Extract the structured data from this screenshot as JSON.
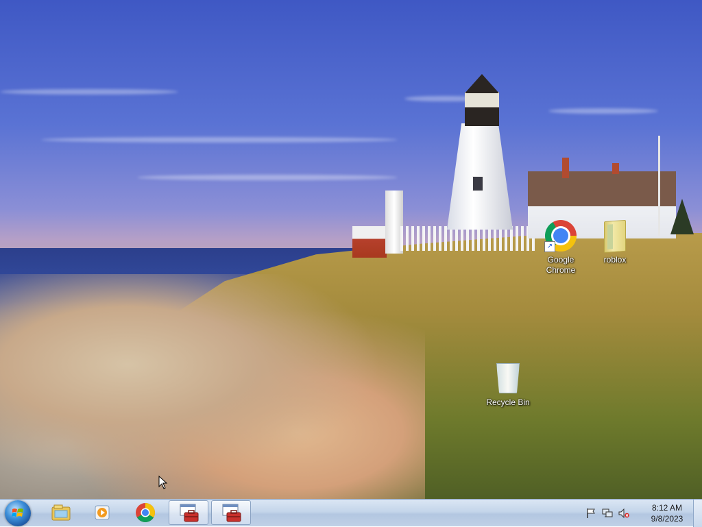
{
  "desktop": {
    "icons": [
      {
        "label": "Google\nChrome",
        "icon": "chrome-icon",
        "shortcut": true
      },
      {
        "label": "roblox",
        "icon": "folder-icon"
      },
      {
        "label": "Recycle Bin",
        "icon": "recycle-bin-icon"
      }
    ]
  },
  "taskbar": {
    "start": {
      "icon": "windows-start-icon"
    },
    "pinned": [
      {
        "name": "Windows Explorer",
        "icon": "explorer-folder-icon"
      },
      {
        "name": "Windows Media Player",
        "icon": "media-player-icon"
      },
      {
        "name": "Google Chrome",
        "icon": "chrome-icon"
      },
      {
        "name": "Toolbox App 1",
        "icon": "toolbox-window-icon",
        "active": true
      },
      {
        "name": "Toolbox App 2",
        "icon": "toolbox-window-icon",
        "active": true
      }
    ],
    "tray": {
      "icons": [
        "action-center-flag-icon",
        "network-icon",
        "volume-muted-icon"
      ],
      "time": "8:12 AM",
      "date": "9/8/2023"
    }
  },
  "colors": {
    "taskbar_top": "#dbe6f4",
    "taskbar_bottom": "#bfd0e6",
    "icon_label": "#ffffff"
  }
}
